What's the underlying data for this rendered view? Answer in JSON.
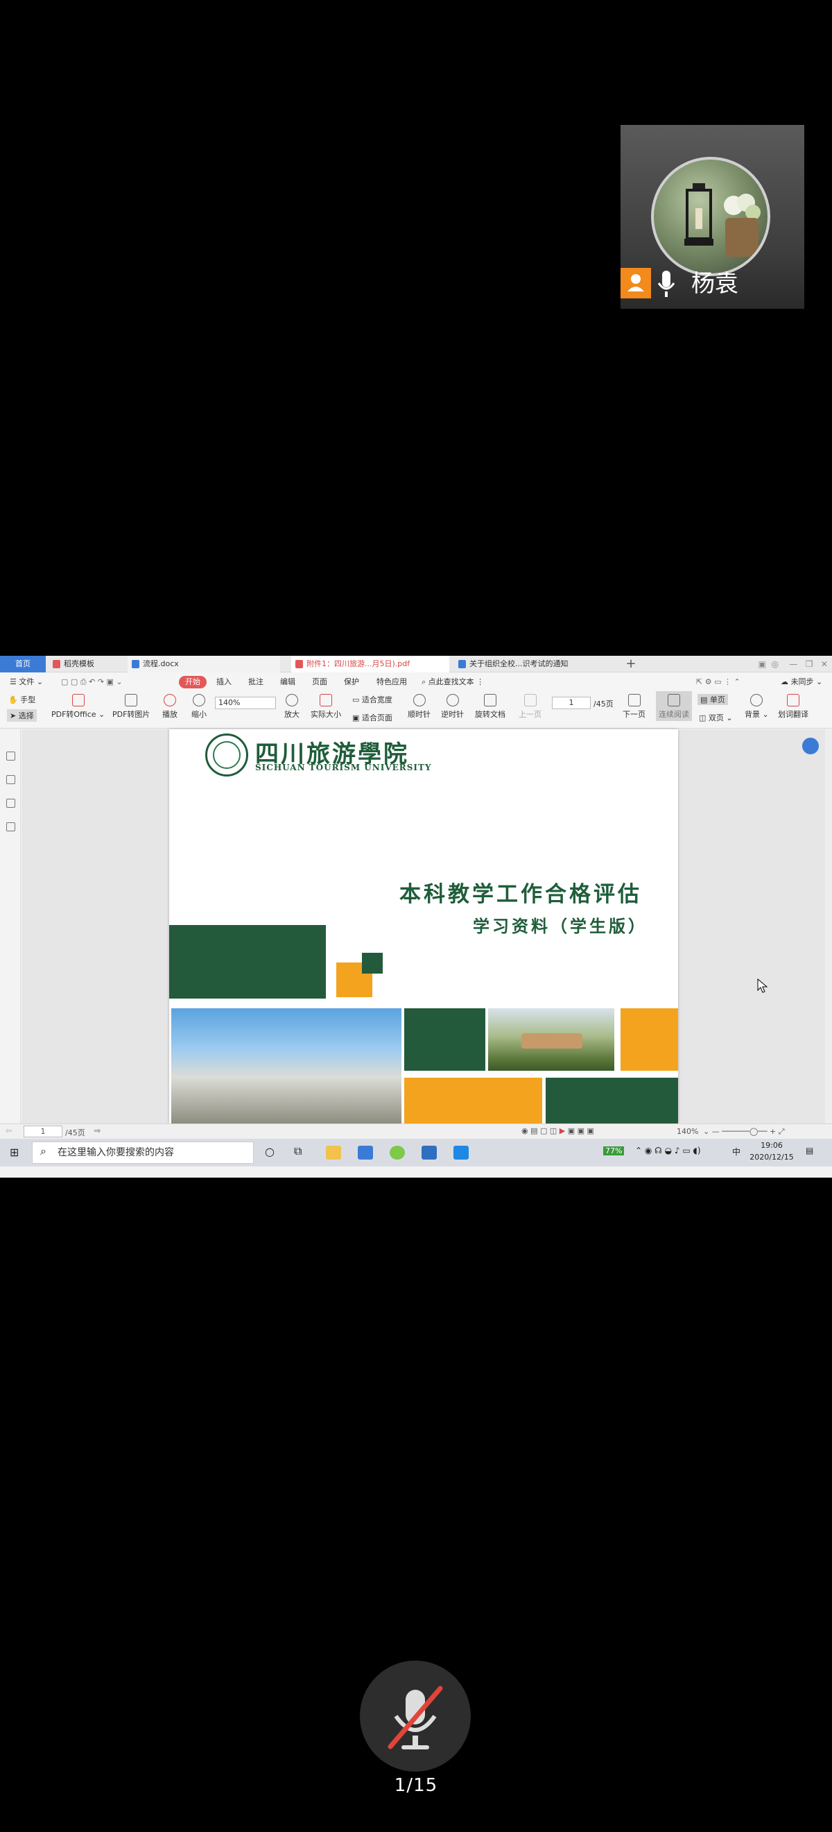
{
  "participant": {
    "name": "杨袁",
    "icons": [
      "user-icon",
      "microphone-icon"
    ]
  },
  "window": {
    "tabs": [
      {
        "label": "首页",
        "active": true
      },
      {
        "label": "稻壳模板",
        "color": "#e25858"
      },
      {
        "label": "流程.docx",
        "color": "#3b7bd6"
      },
      {
        "label": "附件1：四川旅游...月5日).pdf",
        "color": "#e25858",
        "current": true
      },
      {
        "label": "关于组织全校...识考试的通知",
        "color": "#3b7bd6"
      }
    ],
    "new_tab": "+"
  },
  "menu": {
    "file": "文件",
    "items": [
      "开始",
      "插入",
      "批注",
      "编辑",
      "页面",
      "保护",
      "特色应用"
    ],
    "find": "点此查找文本",
    "sync": "未同步"
  },
  "toolbar": {
    "hand": "手型",
    "select": "选择",
    "pdf_office": "PDF转Office",
    "pdf_image": "PDF转图片",
    "play": "播放",
    "zoom_out": "缩小",
    "zoom_value": "140%",
    "zoom_in": "放大",
    "actual_size": "实际大小",
    "fit_width": "适合宽度",
    "fit_page": "适合页面",
    "rotate_cw": "顺时针",
    "rotate_ccw": "逆时针",
    "rotate_doc": "旋转文档",
    "prev_page": "上一页",
    "page_value": "1",
    "page_total": "/45页",
    "next_page": "下一页",
    "continuous": "连续阅读",
    "single": "单页",
    "double": "双页",
    "background": "背景",
    "translate": "划词翻译"
  },
  "document": {
    "school_cn": "四川旅游學院",
    "school_en": "SICHUAN TOURISM UNIVERSITY",
    "title": "本科教学工作合格评估",
    "subtitle": "学习资料（学生版）",
    "colors": {
      "green": "#245a3c",
      "orange": "#f4a31f"
    }
  },
  "statusbar": {
    "page_value": "1",
    "page_total": "/45页",
    "zoom": "140%"
  },
  "taskbar": {
    "search_placeholder": "在这里输入你要搜索的内容",
    "battery": "77%",
    "ime": "中",
    "time": "19:06",
    "date": "2020/12/15"
  },
  "call": {
    "page_indicator": "1/15",
    "mic_muted": true
  }
}
